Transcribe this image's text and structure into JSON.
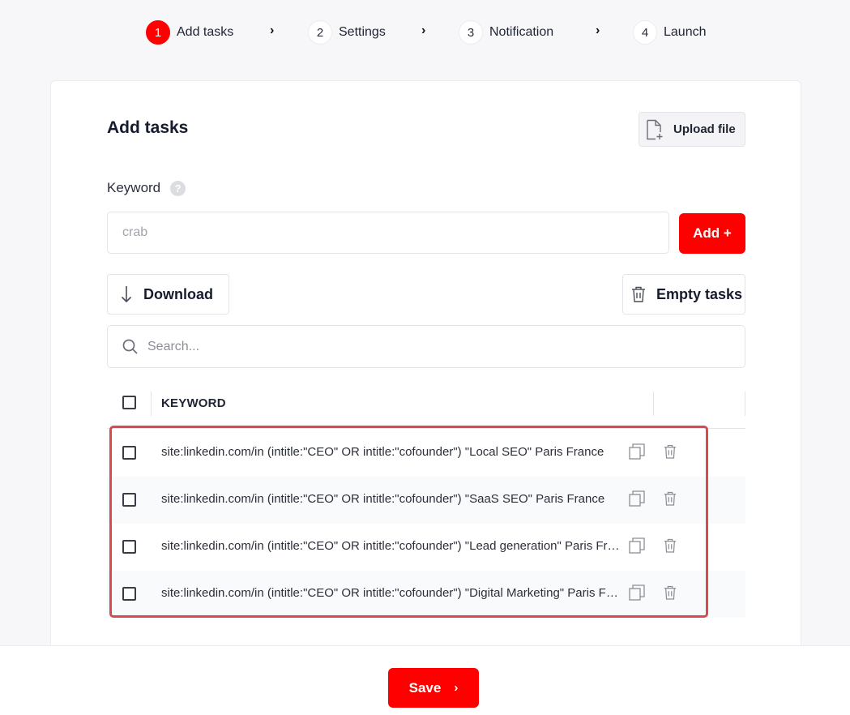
{
  "stepper": {
    "steps": [
      {
        "number": "1",
        "label": "Add tasks",
        "active": true
      },
      {
        "number": "2",
        "label": "Settings",
        "active": false
      },
      {
        "number": "3",
        "label": "Notification",
        "active": false
      },
      {
        "number": "4",
        "label": "Launch",
        "active": false
      }
    ],
    "separator": "›"
  },
  "card": {
    "title": "Add tasks",
    "upload_label": "Upload file",
    "keyword_label": "Keyword",
    "help_glyph": "?",
    "keyword_placeholder": "crab",
    "add_label": "Add +",
    "download_label": "Download",
    "empty_label": "Empty tasks",
    "search_placeholder": "Search..."
  },
  "table": {
    "column_keyword": "KEYWORD",
    "rows": [
      "site:linkedin.com/in (intitle:\"CEO\" OR intitle:\"cofounder\") \"Local SEO\" Paris France",
      "site:linkedin.com/in (intitle:\"CEO\" OR intitle:\"cofounder\") \"SaaS SEO\" Paris France",
      "site:linkedin.com/in (intitle:\"CEO\" OR intitle:\"cofounder\") \"Lead generation\" Paris France",
      "site:linkedin.com/in (intitle:\"CEO\" OR intitle:\"cofounder\") \"Digital Marketing\" Paris France"
    ]
  },
  "footer": {
    "save_label": "Save",
    "save_chevron": "›"
  },
  "colors": {
    "accent": "#ff0000",
    "highlight_border": "#d64a50"
  }
}
